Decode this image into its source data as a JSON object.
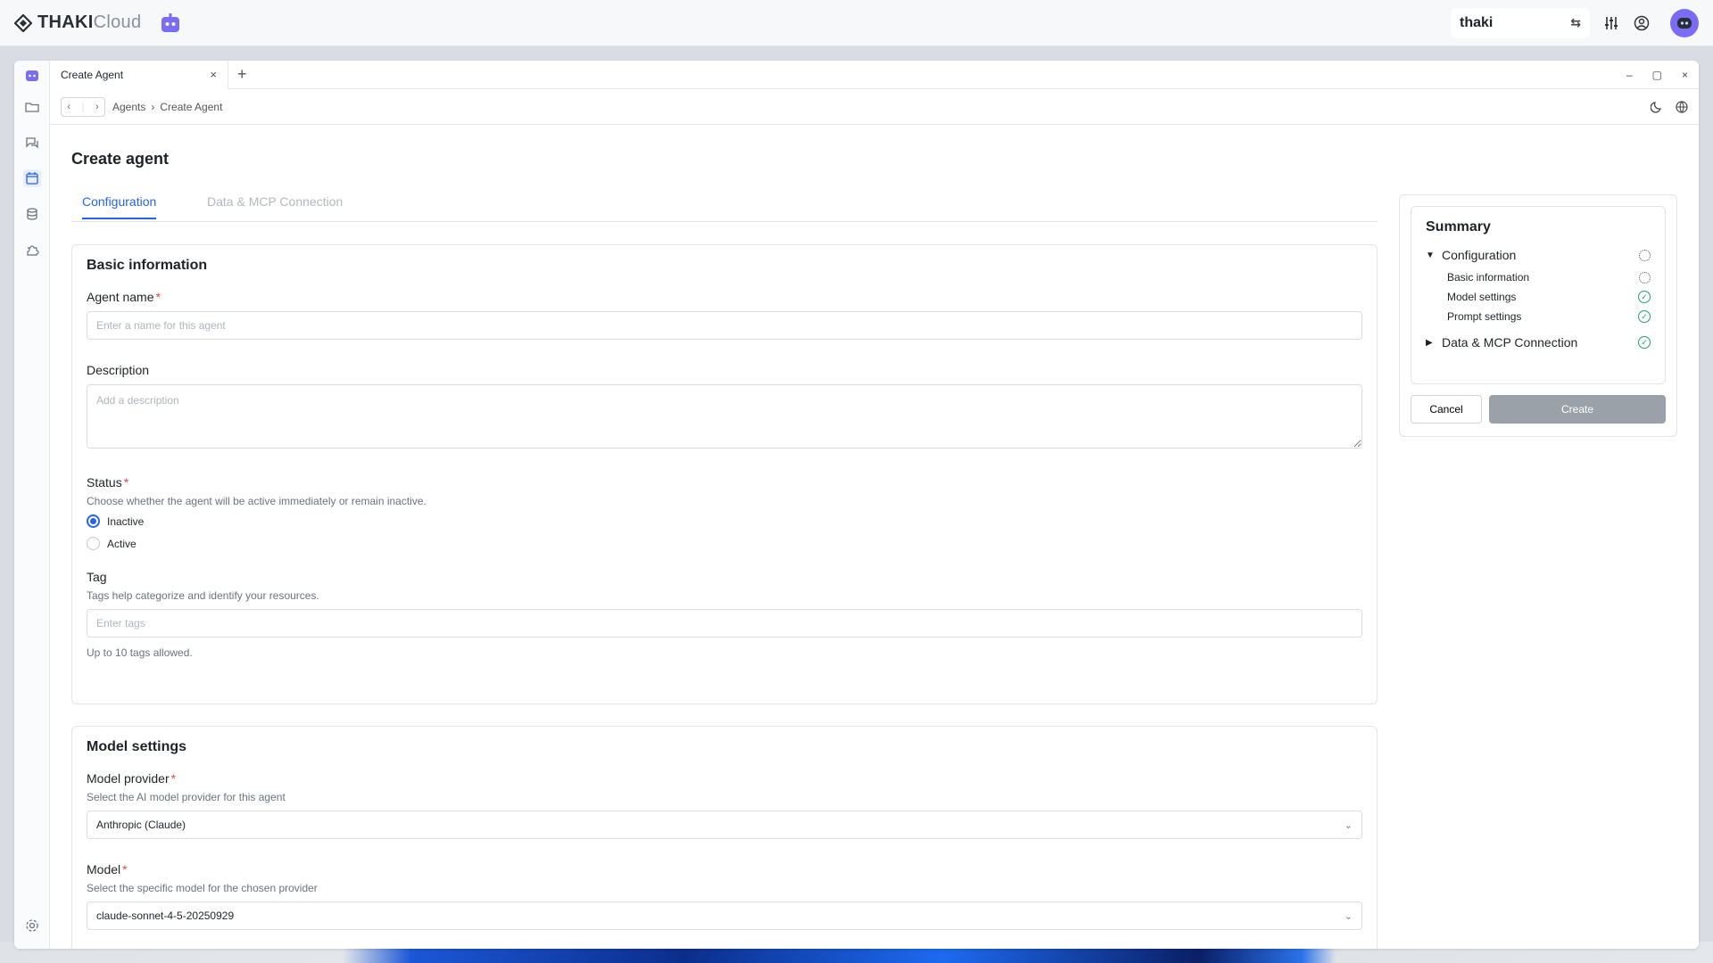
{
  "brand": {
    "name_bold": "THAKI",
    "name_light": "Cloud"
  },
  "workspace": {
    "name": "thaki"
  },
  "window": {
    "tab_title": "Create Agent"
  },
  "breadcrumb": [
    "Agents",
    "Create Agent"
  ],
  "page": {
    "title": "Create agent"
  },
  "tabs": [
    "Configuration",
    "Data & MCP Connection"
  ],
  "basic": {
    "heading": "Basic information",
    "agent_name_label": "Agent name",
    "agent_name_placeholder": "Enter a name for this agent",
    "description_label": "Description",
    "description_placeholder": "Add a description",
    "status_label": "Status",
    "status_help": "Choose whether the agent will be active immediately or remain inactive.",
    "status_options": [
      "Inactive",
      "Active"
    ],
    "status_selected": "Inactive",
    "tag_label": "Tag",
    "tag_help": "Tags help categorize and identify your resources.",
    "tag_placeholder": "Enter tags",
    "tag_note": "Up to 10 tags allowed."
  },
  "model": {
    "heading": "Model settings",
    "provider_label": "Model provider",
    "provider_help": "Select the AI model provider for this agent",
    "provider_value": "Anthropic (Claude)",
    "model_label": "Model",
    "model_help": "Select the specific model for the chosen provider",
    "model_value": "claude-sonnet-4-5-20250929"
  },
  "summary": {
    "title": "Summary",
    "configuration": "Configuration",
    "items": [
      "Basic information",
      "Model settings",
      "Prompt settings"
    ],
    "data_mcp": "Data & MCP Connection",
    "cancel": "Cancel",
    "create": "Create"
  },
  "colors": {
    "accent": "#2563eb",
    "success": "#22a06b",
    "required": "#e5484d",
    "brand_bot": "#7b6cf6"
  }
}
